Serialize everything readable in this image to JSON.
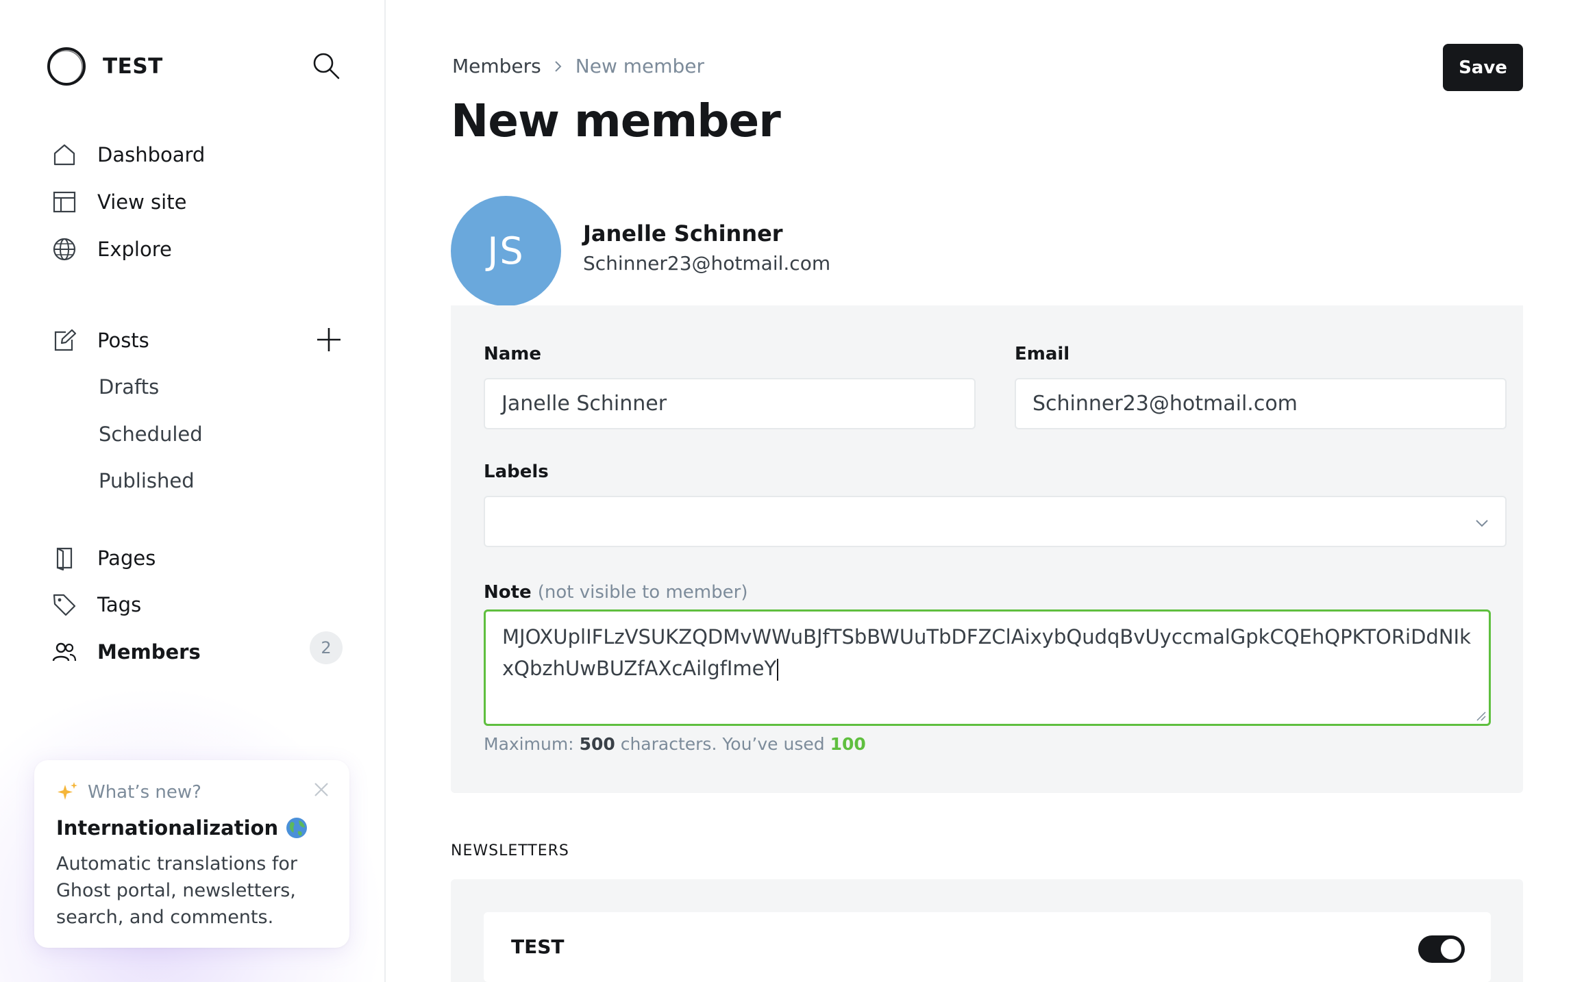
{
  "brand": {
    "name": "TEST"
  },
  "sidebar": {
    "primary": [
      {
        "label": "Dashboard",
        "icon": "home-icon"
      },
      {
        "label": "View site",
        "icon": "layout-icon"
      },
      {
        "label": "Explore",
        "icon": "globe-icon"
      }
    ],
    "posts": {
      "label": "Posts",
      "icon": "edit-icon",
      "subitems": [
        "Drafts",
        "Scheduled",
        "Published"
      ]
    },
    "secondary": [
      {
        "label": "Pages",
        "icon": "page-icon"
      },
      {
        "label": "Tags",
        "icon": "tag-icon"
      },
      {
        "label": "Members",
        "icon": "members-icon",
        "count": "2",
        "active": true
      }
    ]
  },
  "whats_new": {
    "header": "What’s new?",
    "title": "Internationalization",
    "body": "Automatic translations for Ghost portal, newsletters, search, and comments."
  },
  "breadcrumb": {
    "parent": "Members",
    "current": "New member"
  },
  "page_title": "New member",
  "save_label": "Save",
  "member": {
    "initials": "JS",
    "name": "Janelle Schinner",
    "email": "Schinner23@hotmail.com",
    "avatar_color": "#6aa8dc"
  },
  "form": {
    "name_label": "Name",
    "name_value": "Janelle Schinner",
    "email_label": "Email",
    "email_value": "Schinner23@hotmail.com",
    "labels_label": "Labels",
    "labels_value": "",
    "note_label": "Note",
    "note_sublabel": "(not visible to member)",
    "note_value": "MJOXUplIFLzVSUKZQDMvWWuBJfTSbBWUuTbDFZClAixybQudqBvUyccmalGpkCQEhQPKTORiDdNIkxQbzhUwBUZfAXcAilgfImeY",
    "hint_prefix": "Maximum:",
    "hint_max": "500",
    "hint_middle": "characters. You’ve used",
    "hint_used": "100"
  },
  "newsletters": {
    "heading": "NEWSLETTERS",
    "items": [
      {
        "name": "TEST",
        "subscribed": true
      }
    ]
  },
  "colors": {
    "accent_green": "#5fbf3f",
    "dark": "#15171a",
    "avatar": "#6aa8dc"
  }
}
